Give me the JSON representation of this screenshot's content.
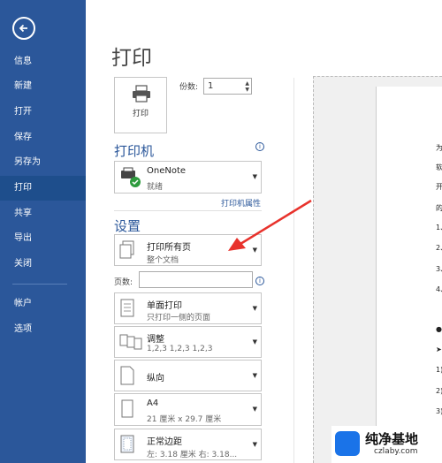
{
  "sidebar": {
    "items": [
      {
        "label": "信息"
      },
      {
        "label": "新建"
      },
      {
        "label": "打开"
      },
      {
        "label": "保存"
      },
      {
        "label": "另存为"
      },
      {
        "label": "打印"
      },
      {
        "label": "共享"
      },
      {
        "label": "导出"
      },
      {
        "label": "关闭"
      },
      {
        "label": "帐户"
      },
      {
        "label": "选项"
      }
    ],
    "active": "打印"
  },
  "main": {
    "title": "打印",
    "print_button_label": "打印",
    "copies_label": "份数:",
    "copies_value": "1",
    "printer_section": "打印机",
    "printer_name": "OneNote",
    "printer_status": "就绪",
    "printer_properties_link": "打印机属性",
    "settings_section": "设置",
    "pages_label": "页数:",
    "settings": [
      {
        "line1": "打印所有页",
        "line2": "整个文档",
        "icon": "pages-icon"
      },
      {
        "line1": "单面打印",
        "line2": "只打印一侧的页面",
        "icon": "single-side-icon"
      },
      {
        "line1": "调整",
        "line2": "1,2,3    1,2,3    1,2,3",
        "icon": "collate-icon"
      },
      {
        "line1": "纵向",
        "line2": "",
        "icon": "portrait-icon"
      },
      {
        "line1": "A4",
        "line2": "21 厘米 x 29.7 厘米",
        "icon": "paper-icon"
      },
      {
        "line1": "正常边距",
        "line2": "左: 3.18 厘米   右: 3.18...",
        "icon": "margins-icon"
      }
    ]
  },
  "preview": {
    "fragments": [
      "为",
      "软",
      "开",
      "的",
      "1、",
      "2、",
      "3、",
      "4、",
      "●",
      "➤",
      "1)",
      "2)",
      "3)"
    ]
  },
  "watermark": {
    "title": "纯净基地",
    "subtitle": "czlaby.com"
  },
  "colors": {
    "sidebar": "#2b579a",
    "accent": "#2b579a",
    "arrow": "#e8322c"
  }
}
